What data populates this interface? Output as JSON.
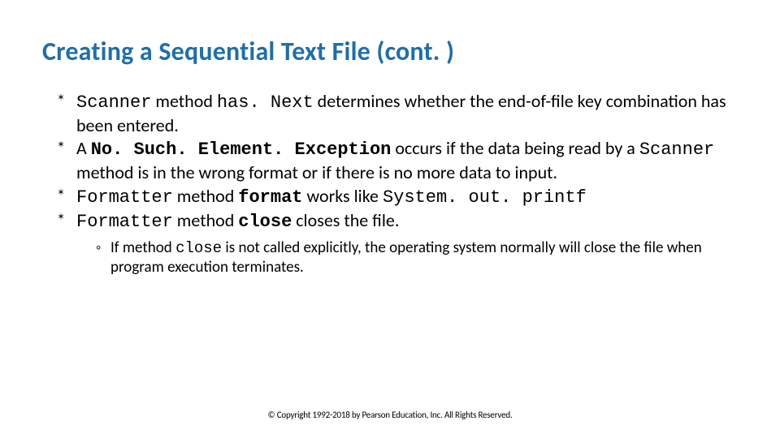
{
  "title": "Creating a Sequential Text File (cont. )",
  "bullets": {
    "b1": {
      "code1": "Scanner",
      "t1": " method ",
      "code2": "has. Next",
      "t2": " determines whether the end-of-file key combination has been entered."
    },
    "b2": {
      "t1": "A ",
      "code1": "No. Such. Element. Exception",
      "t2": " occurs if the data being read by a ",
      "code2": "Scanner",
      "t3": " method is in the wrong format or if there is no more data to input."
    },
    "b3": {
      "code1": "Formatter",
      "t1": " method ",
      "code2": "format",
      "t2": " works like ",
      "code3": "System. out. printf"
    },
    "b4": {
      "code1": "Formatter",
      "t1": " method ",
      "code2": "close",
      "t2": " closes the file."
    },
    "sub1": {
      "t1": "If method ",
      "code1": "close",
      "t2": " is not called explicitly, the operating system normally will close the file when program execution terminates."
    }
  },
  "footer": "© Copyright 1992-2018 by Pearson Education, Inc. All Rights Reserved."
}
